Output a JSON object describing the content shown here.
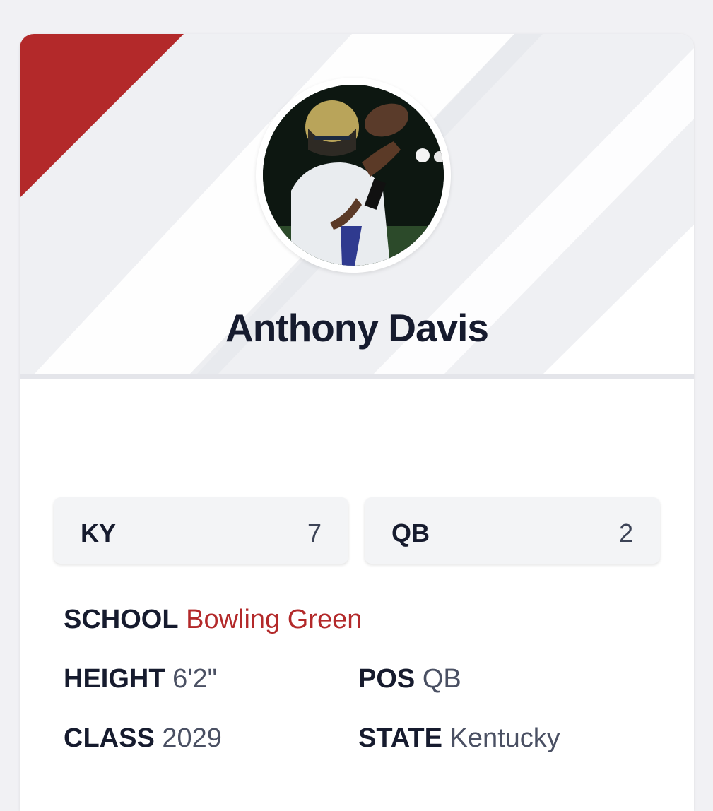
{
  "profile": {
    "name": "Anthony Davis",
    "avatar_alt": "player-photo"
  },
  "rankings": [
    {
      "label": "KY",
      "value": "7"
    },
    {
      "label": "QB",
      "value": "2"
    }
  ],
  "details": {
    "school_label": "SCHOOL",
    "school_value": "Bowling Green",
    "height_label": "HEIGHT",
    "height_value": "6'2\"",
    "pos_label": "POS",
    "pos_value": "QB",
    "class_label": "CLASS",
    "class_value": "2029",
    "state_label": "STATE",
    "state_value": "Kentucky"
  },
  "colors": {
    "accent": "#b3292a",
    "text_dark": "#161b2e",
    "text_muted": "#4a5063",
    "page_bg": "#f1f1f4",
    "hero_bg": "#f0f1f4"
  }
}
